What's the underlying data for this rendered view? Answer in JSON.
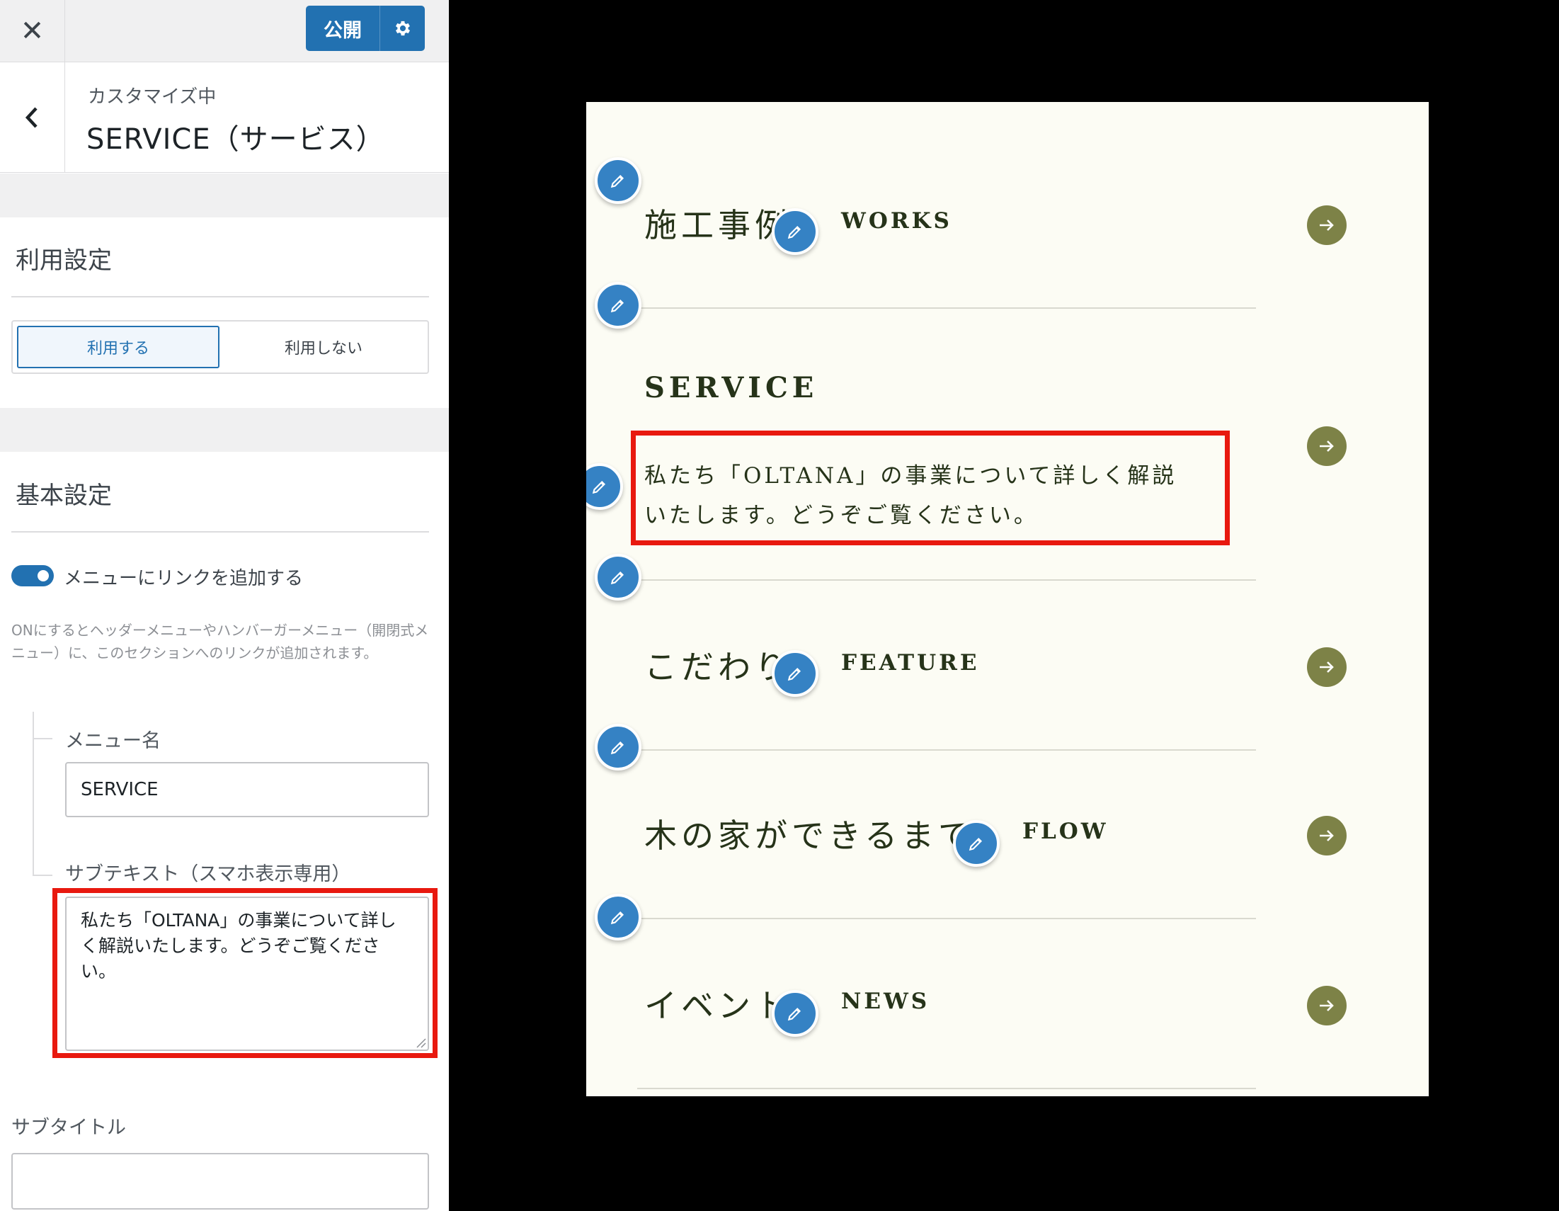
{
  "topbar": {
    "close_icon": "close-icon",
    "publish_label": "公開",
    "settings_icon": "gear-icon"
  },
  "section": {
    "customizing_label": "カスタマイズ中",
    "title": "SERVICE（サービス）",
    "back_icon": "chevron-left-icon"
  },
  "usage": {
    "heading": "利用設定",
    "options": [
      "利用する",
      "利用しない"
    ],
    "selected": "利用する"
  },
  "basic": {
    "heading": "基本設定",
    "menu_link_toggle_label": "メニューにリンクを追加する",
    "menu_link_toggle_on": true,
    "help_text": "ONにするとヘッダーメニューやハンバーガーメニュー（開閉式メニュー）に、このセクションへのリンクが追加されます。",
    "menu_name_label": "メニュー名",
    "menu_name_value": "SERVICE",
    "subtext_label": "サブテキスト（スマホ表示専用）",
    "subtext_value": "私たち「OLTANA」の事業について詳しく解説いたします。どうぞご覧ください。",
    "subtitle_label": "サブタイトル",
    "subtitle_value": ""
  },
  "preview": {
    "items": [
      {
        "jp": "施工事例",
        "en": "WORKS"
      },
      {
        "jp": "",
        "en": "SERVICE",
        "desc_line1": "私たち「OLTANA」の事業について詳しく解説",
        "desc_line2": "いたします。どうぞご覧ください。"
      },
      {
        "jp": "こだわり",
        "en": "FEATURE"
      },
      {
        "jp": "木の家ができるまで",
        "en": "FLOW"
      },
      {
        "jp": "イベント",
        "en": "NEWS"
      }
    ],
    "edit_icon": "pencil-icon",
    "arrow_icon": "arrow-right-icon"
  },
  "colors": {
    "accent_blue": "#2271b1",
    "highlight_red": "#e8190f",
    "preview_bg": "#fcfcf4",
    "arrow_olive": "#7d8247",
    "preview_text": "#263319"
  }
}
